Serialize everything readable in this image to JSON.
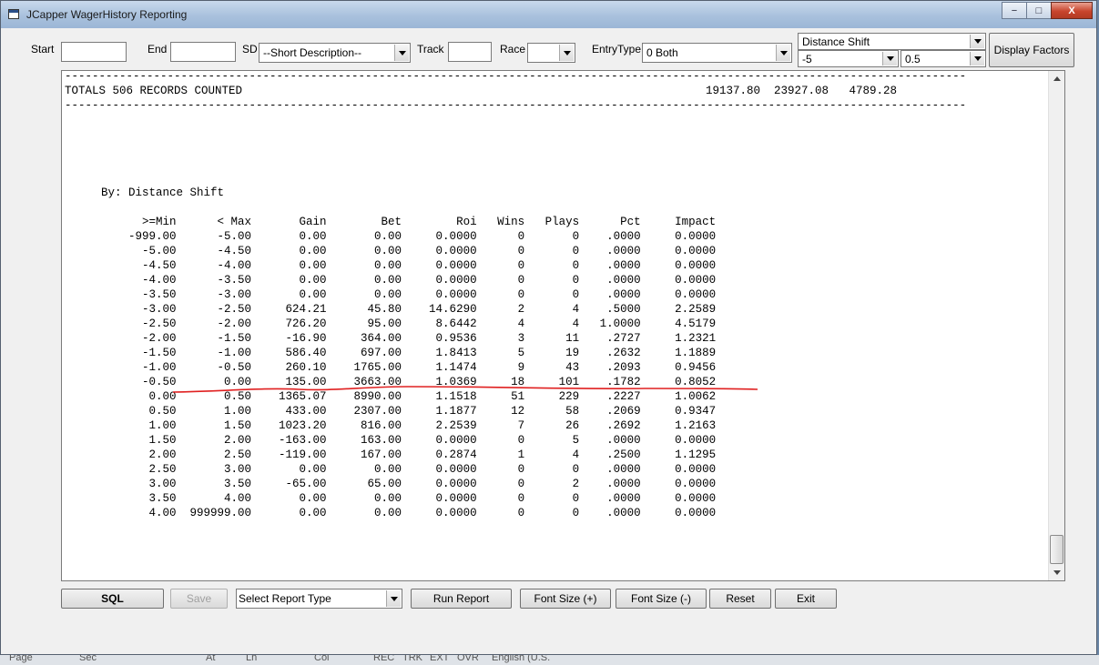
{
  "window": {
    "title": "JCapper WagerHistory Reporting",
    "min": "−",
    "max": "□",
    "close": "X"
  },
  "toolbar": {
    "start_label": "Start",
    "end_label": "End",
    "sd_label": "SD",
    "sd_value": "--Short Description--",
    "track_label": "Track",
    "race_label": "Race",
    "entrytype_label": "EntryType",
    "entrytype_value": "0 Both",
    "factor_value": "Distance Shift",
    "factor_min": "-5",
    "factor_step": "0.5",
    "display_factors": "Display Factors"
  },
  "report": {
    "dash": "------------------------------------------------------------------------------------------------------------------------------------",
    "totals_label": "TOTALS 506 RECORDS COUNTED",
    "totals_values": "19137.80  23927.08   4789.28",
    "by_line": "By: Distance Shift",
    "header": "      >=Min      < Max       Gain        Bet        Roi   Wins   Plays      Pct     Impact",
    "rows": [
      "    -999.00      -5.00       0.00       0.00     0.0000      0       0    .0000     0.0000",
      "      -5.00      -4.50       0.00       0.00     0.0000      0       0    .0000     0.0000",
      "      -4.50      -4.00       0.00       0.00     0.0000      0       0    .0000     0.0000",
      "      -4.00      -3.50       0.00       0.00     0.0000      0       0    .0000     0.0000",
      "      -3.50      -3.00       0.00       0.00     0.0000      0       0    .0000     0.0000",
      "      -3.00      -2.50     624.21      45.80    14.6290      2       4    .5000     2.2589",
      "      -2.50      -2.00     726.20      95.00     8.6442      4       4   1.0000     4.5179",
      "      -2.00      -1.50     -16.90     364.00     0.9536      3      11    .2727     1.2321",
      "      -1.50      -1.00     586.40     697.00     1.8413      5      19    .2632     1.1889",
      "      -1.00      -0.50     260.10    1765.00     1.1474      9      43    .2093     0.9456",
      "      -0.50       0.00     135.00    3663.00     1.0369     18     101    .1782     0.8052",
      "       0.00       0.50    1365.07    8990.00     1.1518     51     229    .2227     1.0062",
      "       0.50       1.00     433.00    2307.00     1.1877     12      58    .2069     0.9347",
      "       1.00       1.50    1023.20     816.00     2.2539      7      26    .2692     1.2163",
      "       1.50       2.00    -163.00     163.00     0.0000      0       5    .0000     0.0000",
      "       2.00       2.50    -119.00     167.00     0.2874      1       4    .2500     1.1295",
      "       2.50       3.00       0.00       0.00     0.0000      0       0    .0000     0.0000",
      "       3.00       3.50     -65.00      65.00     0.0000      0       2    .0000     0.0000",
      "       3.50       4.00       0.00       0.00     0.0000      0       0    .0000     0.0000",
      "       4.00  999999.00       0.00       0.00     0.0000      0       0    .0000     0.0000"
    ]
  },
  "bottom": {
    "sql": "SQL",
    "save": "Save",
    "report_type": "Select Report Type",
    "run": "Run Report",
    "font_plus": "Font Size (+)",
    "font_minus": "Font Size (-)",
    "reset": "Reset",
    "exit": "Exit"
  },
  "background_strip": [
    "Page",
    "Sec",
    "At",
    "Ln",
    "Col",
    "REC",
    "TRK",
    "EXT",
    "OVR",
    "English (U.S."
  ]
}
